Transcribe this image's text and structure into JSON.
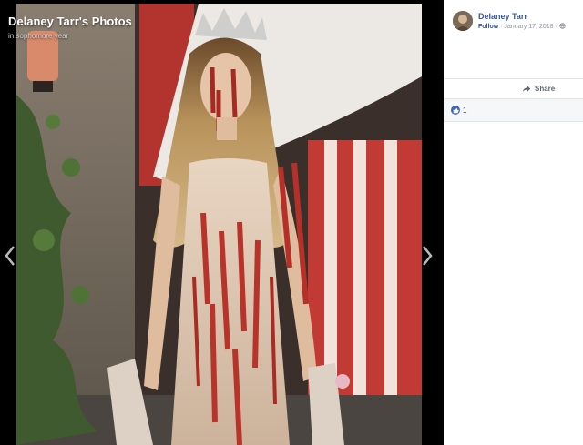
{
  "album": {
    "title": "Delaney Tarr's Photos",
    "subtitle": "in sophomore year"
  },
  "post": {
    "owner_name": "Delaney Tarr",
    "follow_label": "Follow",
    "date": "January 17, 2018",
    "privacy_icon": "globe-icon",
    "share_label": "Share",
    "reaction_count": "1",
    "reaction_icon": "like-icon"
  },
  "colors": {
    "link": "#365899",
    "meta": "#90949c",
    "like": "#4267b2"
  }
}
